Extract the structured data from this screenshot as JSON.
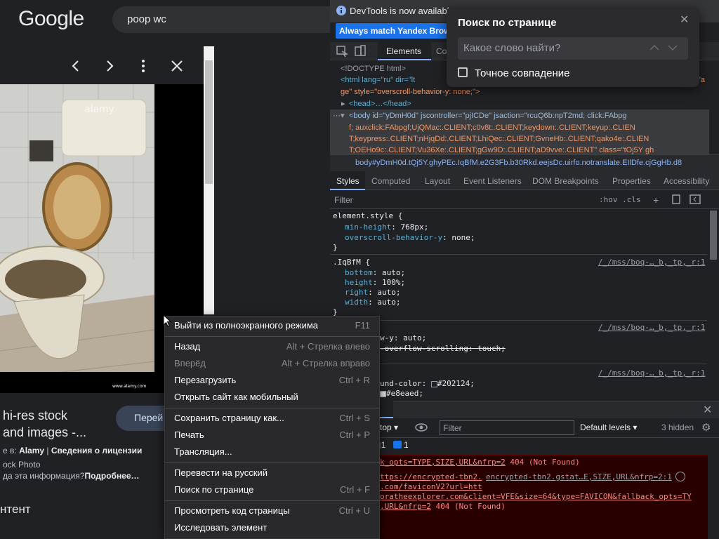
{
  "google": {
    "logo": "Google",
    "search_value": "poop wc",
    "card_title_line1": "hi-res stock",
    "card_title_line2": "and images -...",
    "visit_label": "Перей",
    "meta_line1_prefix": "е в: ",
    "meta_line1_source": "Alamy",
    "meta_line1_sep": " | ",
    "meta_line1_license": "Сведения о лицензии",
    "meta_line2": "ock Photo",
    "meta_line3_prefix": "да эта информация?",
    "meta_line3_more": "Подробнее…",
    "content_heading": "нтент",
    "image_watermark": "alamy",
    "image_credit": "www.alamy.com"
  },
  "devtools": {
    "info_text": "DevTools is now available",
    "match_button": "Always match Yandex Brows",
    "tabs": {
      "elements": "Elements",
      "console_partial": "Co"
    },
    "dom_lines": {
      "doctype": "<!DOCTYPE html>",
      "html_open": "<html lang=\"ru\" dir=\"lt",
      "html_cont": "ge\" style=\"overscroll-behavior-y: none;\">",
      "html_tail": "\"a",
      "head": "<head>…</head>",
      "body_1": "<body id=\"yDmH0d\" jscontroller=\"pjICDe\" jsaction=\"rcuQ6b:npT2md; click:FAbpg",
      "body_2": "f; auxclick:FAbpgf;UjQMac:.CLIENT;c0v8t:.CLIENT;keydown:.CLIENT;keyup:.CLIEN",
      "body_3": "T;keypress:.CLIENT;nHjqDd:.CLIENT;LhiQec:.CLIENT;GvneHb:.CLIENT;qako4e:.CLIEN",
      "body_4": "T;OEHo9c:.CLIENT;Vu36Xe:.CLIENT;gGw9D:.CLIENT;aD9vve:.CLIENT\" class=\"tOj5Y gh"
    },
    "breadcrumb": "body#yDmH0d.tQj5Y.ghyPEc.IqBfM.e2G3Fb.b30Rkd.eejsDc.uirfo.notranslate.EIlDfe.cjGgHb.d8",
    "subtabs": [
      "Styles",
      "Computed",
      "Layout",
      "Event Listeners",
      "DOM Breakpoints",
      "Properties",
      "Accessibility"
    ],
    "filter_placeholder": "Filter",
    "hov_cls": ":hov  .cls",
    "styles": {
      "rule1_selector": "element.style {",
      "rule1_p1_name": "min-height",
      "rule1_p1_val": "768px;",
      "rule1_p2_name": "overscroll-behavior-y",
      "rule1_p2_val": "none;",
      "close": "}",
      "rule2_selector": ".IqBfM {",
      "rule2_source": "/_/mss/boq-…_b,_tp,_r:1",
      "rule2_p1_name": "bottom",
      "rule2_p1_val": "auto;",
      "rule2_p2_name": "height",
      "rule2_p2_val": "100%;",
      "rule2_p3_name": "right",
      "rule2_p3_val": "auto;",
      "rule2_p4_name": "width",
      "rule2_p4_val": "auto;",
      "rule3_source": "/_/mss/boq-…_b,_tp,_r:1",
      "rule3_p1": "w-y: auto;",
      "rule3_p2": "-overflow-scrolling: touch;",
      "rule4_source": "/_/mss/boq-…_b,_tp,_r:1",
      "rule4_p1": "und-color: ",
      "rule4_p1_val": "#202124;",
      "rule4_p2_val": "#e8eaed;"
    },
    "console": {
      "tab_label": "le",
      "context": "top",
      "filter_placeholder": "Filter",
      "levels": "Default levels",
      "hidden": "3 hidden",
      "badge_warn": "1",
      "badge_info": "1",
      "err1_link": "k_opts=TYPE,SIZE,URL&nfrp=2",
      "err1_status": " 404 (Not Found)",
      "err2_line1": "ttps://encrypted-tbn2.",
      "err2_source": "encrypted-tbn2.gstat…E,SIZE,URL&nfrp=2:1",
      "err2_line2": ".com/faviconV2?url=htt",
      "err2_line3": "oratheexplorer.com&client=VFE&size=64&type=FAVICON&fallback_opts=TY",
      "err2_line4": ",URL&nfrp=2",
      "err2_status": " 404 (Not Found)"
    }
  },
  "find": {
    "title": "Поиск по странице",
    "placeholder": "Какое слово найти?",
    "exact_match": "Точное совпадение"
  },
  "context_menu": {
    "items": [
      {
        "label": "Выйти из полноэкранного режима",
        "shortcut": "F11",
        "disabled": false
      },
      {
        "label": "Назад",
        "shortcut": "Alt + Стрелка влево",
        "disabled": false
      },
      {
        "label": "Вперёд",
        "shortcut": "Alt + Стрелка вправо",
        "disabled": true
      },
      {
        "label": "Перезагрузить",
        "shortcut": "Ctrl + R",
        "disabled": false
      },
      {
        "label": "Открыть сайт как мобильный",
        "shortcut": "",
        "disabled": false
      },
      {
        "label": "Сохранить страницу как...",
        "shortcut": "Ctrl + S",
        "disabled": false
      },
      {
        "label": "Печать",
        "shortcut": "Ctrl + P",
        "disabled": false
      },
      {
        "label": "Трансляция...",
        "shortcut": "",
        "disabled": false
      },
      {
        "label": "Перевести на русский",
        "shortcut": "",
        "disabled": false
      },
      {
        "label": "Поиск по странице",
        "shortcut": "Ctrl + F",
        "disabled": false
      },
      {
        "label": "Просмотреть код страницы",
        "shortcut": "Ctrl + U",
        "disabled": false
      },
      {
        "label": "Исследовать элемент",
        "shortcut": "",
        "disabled": false
      }
    ]
  },
  "colors": {
    "page_bg": "#202124",
    "devtools_accent": "#8ab4f8",
    "match_button": "#1a73e8",
    "error_bg": "#290000",
    "menu_bg": "#29292b"
  }
}
